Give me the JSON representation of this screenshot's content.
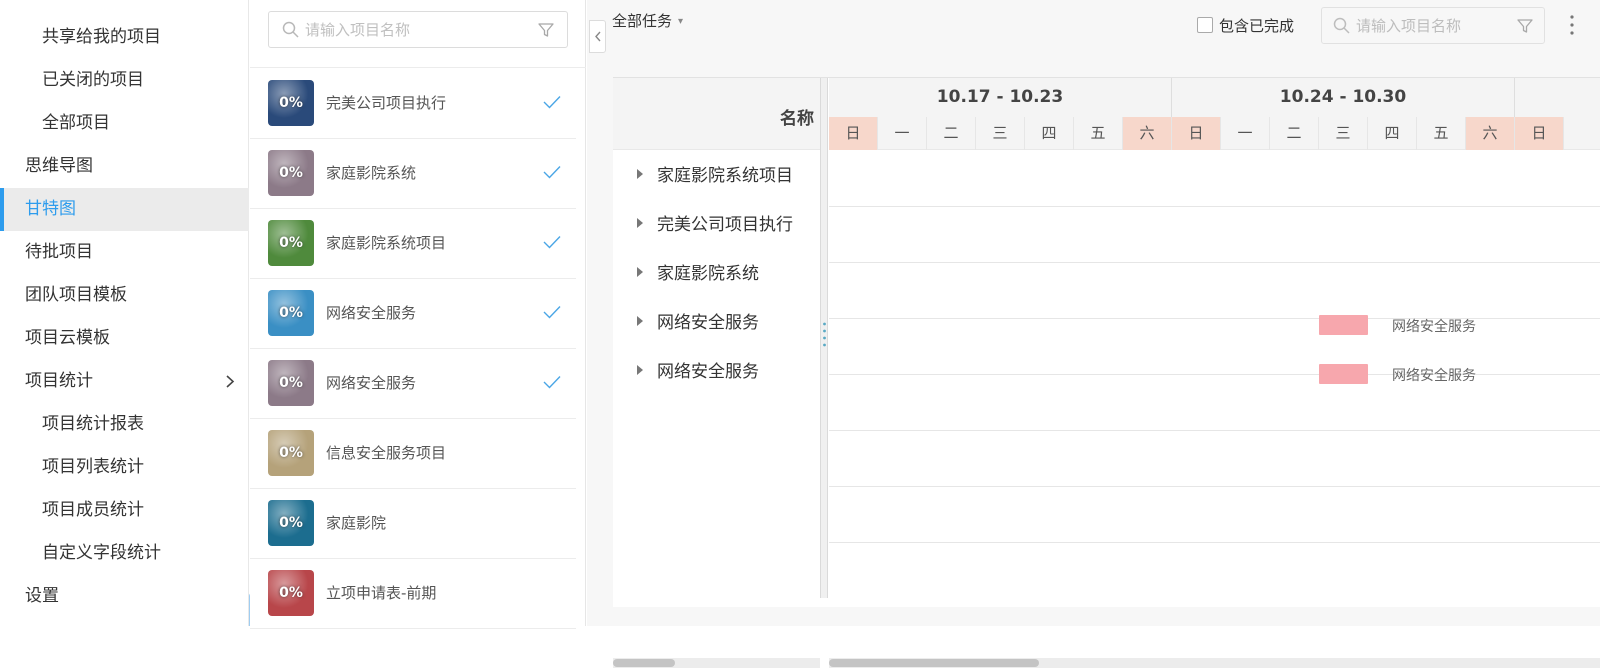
{
  "nav": {
    "items": [
      {
        "label": "共享给我的项目",
        "sub": true
      },
      {
        "label": "已关闭的项目",
        "sub": true
      },
      {
        "label": "全部项目",
        "sub": true
      },
      {
        "label": "思维导图",
        "sub": false
      },
      {
        "label": "甘特图",
        "sub": false,
        "active": true
      },
      {
        "label": "待批项目",
        "sub": false
      },
      {
        "label": "团队项目模板",
        "sub": false
      },
      {
        "label": "项目云模板",
        "sub": false
      },
      {
        "label": "项目统计",
        "sub": false,
        "expand_icon": "chevron-right-icon"
      },
      {
        "label": "项目统计报表",
        "sub": true
      },
      {
        "label": "项目列表统计",
        "sub": true
      },
      {
        "label": "项目成员统计",
        "sub": true
      },
      {
        "label": "自定义字段统计",
        "sub": true
      },
      {
        "label": "设置",
        "sub": false
      }
    ],
    "collapse_icon": "chevron-left-icon",
    "accent_color": "#2d9ced"
  },
  "project_list": {
    "search_placeholder": "请输入项目名称",
    "search_icon": "search-icon",
    "filter_icon": "filter-icon",
    "projects": [
      {
        "name": "完美公司项目执行",
        "progress": "0%",
        "checked": true,
        "thumb_color": "#2a4a7a"
      },
      {
        "name": "家庭影院系统",
        "progress": "0%",
        "checked": true,
        "thumb_color": "#8c7a88"
      },
      {
        "name": "家庭影院系统项目",
        "progress": "0%",
        "checked": true,
        "thumb_color": "#4f8a3c"
      },
      {
        "name": "网络安全服务",
        "progress": "0%",
        "checked": true,
        "thumb_color": "#3a8fc4"
      },
      {
        "name": "网络安全服务",
        "progress": "0%",
        "checked": true,
        "thumb_color": "#8c7a88"
      },
      {
        "name": "信息安全服务项目",
        "progress": "0%",
        "checked": false,
        "thumb_color": "#b5a27a"
      },
      {
        "name": "家庭影院",
        "progress": "0%",
        "checked": false,
        "thumb_color": "#1c6d8f"
      },
      {
        "name": "立项申请表-前期",
        "progress": "0%",
        "checked": false,
        "thumb_color": "#b8464a"
      }
    ]
  },
  "toolbar": {
    "task_filter": "全部任务",
    "task_filter_caret": "▾",
    "include_completed": "包含已完成",
    "search_placeholder": "请输入项目名称",
    "more_icon": "more-vertical-icon",
    "collapse_panel_icon": "chevron-left-icon"
  },
  "gantt": {
    "name_header": "名称",
    "weeks": [
      "10.17 - 10.23",
      "10.24 - 10.30"
    ],
    "days": [
      "日",
      "一",
      "二",
      "三",
      "四",
      "五",
      "六",
      "日",
      "一",
      "二",
      "三",
      "四",
      "五",
      "六",
      "日"
    ],
    "weekend_color": "#f7d7cb",
    "tasks": [
      {
        "name": "家庭影院系统项目"
      },
      {
        "name": "完美公司项目执行"
      },
      {
        "name": "家庭影院系统"
      },
      {
        "name": "网络安全服务",
        "bar_label": "网络安全服务"
      },
      {
        "name": "网络安全服务",
        "bar_label": "网络安全服务"
      }
    ],
    "bar_color": "#f7a7ad"
  }
}
